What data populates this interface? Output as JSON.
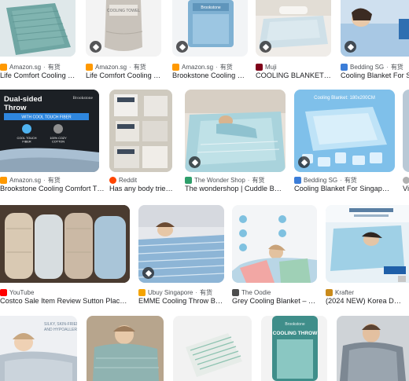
{
  "row1": [
    {
      "source": "Amazon.sg",
      "stock": "有货",
      "title": "Life Comfort Cooling T…",
      "fav": "#ff9900"
    },
    {
      "source": "Amazon.sg",
      "stock": "有货",
      "title": "Life Comfort Cooling T…",
      "fav": "#ff9900"
    },
    {
      "source": "Amazon.sg",
      "stock": "有货",
      "title": "Brookstone Cooling C…",
      "fav": "#ff9900"
    },
    {
      "source": "Muji",
      "stock": "",
      "title": "COOLING BLANKET …",
      "fav": "#7f0019"
    },
    {
      "source": "Bedding SG",
      "stock": "有货",
      "title": "Cooling Blanket For Si",
      "fav": "#3b7dd8"
    }
  ],
  "row2": [
    {
      "source": "Amazon.sg",
      "stock": "有货",
      "title": "Brookstone Cooling Comfort T…",
      "fav": "#ff9900"
    },
    {
      "source": "Reddit",
      "stock": "",
      "title": "Has any body tried…",
      "fav": "#ff4500"
    },
    {
      "source": "The Wonder Shop",
      "stock": "有货",
      "title": "The wondershop | Cuddle Bed…",
      "fav": "#2e9e6a"
    },
    {
      "source": "Bedding SG",
      "stock": "有货",
      "title": "Cooling Blanket For Singapore…",
      "fav": "#3b7dd8"
    },
    {
      "source": "",
      "stock": "",
      "title": "Vi",
      "fav": "#b0b0b0"
    }
  ],
  "row3": [
    {
      "source": "YouTube",
      "stock": "",
      "title": "Costco Sale Item Review Sutton Place C…",
      "fav": "#ff0000"
    },
    {
      "source": "Ubuy Singapore",
      "stock": "有货",
      "title": "EMME Cooling Throw Bl…",
      "fav": "#f4a300"
    },
    {
      "source": "The Oodie",
      "stock": "",
      "title": "Grey Cooling Blanket – T…",
      "fav": "#4d4d4d"
    },
    {
      "source": "Krafter",
      "stock": "",
      "title": "(2024 NEW) Korea D…",
      "fav": "#c98a1b"
    }
  ],
  "image_text": {
    "dual_sided": "Dual-sided Throw",
    "cool_touch": "WITH COOL TOUCH FIBER",
    "brookstone": "Brookstone",
    "cool_touch_fiber": "COOL TOUCH FIBER",
    "cotton": "100% COZY COTTON",
    "cooling_blanket_size": "Cooling Blanket: 180x200CM",
    "cooling_throw": "COOLING THROW",
    "brand_pkg": "Brookstone"
  }
}
